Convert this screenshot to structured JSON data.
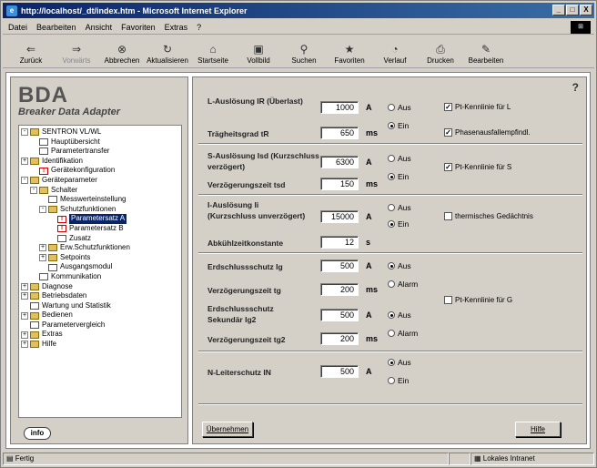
{
  "window": {
    "title": "http://localhost/_dt/index.htm - Microsoft Internet Explorer",
    "controls": [
      "_",
      "□",
      "X"
    ]
  },
  "menu": [
    "Datei",
    "Bearbeiten",
    "Ansicht",
    "Favoriten",
    "Extras",
    "?"
  ],
  "toolbar": [
    {
      "label": "Zurück",
      "icon": "back-arrow-icon",
      "glyph": "⇐",
      "disabled": false
    },
    {
      "label": "Vorwärts",
      "icon": "forward-arrow-icon",
      "glyph": "⇒",
      "disabled": true
    },
    {
      "label": "Abbrechen",
      "icon": "stop-icon",
      "glyph": "⊗",
      "disabled": false
    },
    {
      "label": "Aktualisieren",
      "icon": "refresh-icon",
      "glyph": "↻",
      "disabled": false
    },
    {
      "label": "Startseite",
      "icon": "home-icon",
      "glyph": "⌂",
      "disabled": false
    },
    {
      "label": "Vollbild",
      "icon": "fullscreen-icon",
      "glyph": "▣",
      "disabled": false
    },
    {
      "label": "Suchen",
      "icon": "search-icon",
      "glyph": "⚲",
      "disabled": false
    },
    {
      "label": "Favoriten",
      "icon": "favorites-icon",
      "glyph": "★",
      "disabled": false
    },
    {
      "label": "Verlauf",
      "icon": "history-icon",
      "glyph": "◔",
      "disabled": false
    },
    {
      "label": "Drucken",
      "icon": "print-icon",
      "glyph": "⎙",
      "disabled": false
    },
    {
      "label": "Bearbeiten",
      "icon": "edit-icon",
      "glyph": "✎",
      "disabled": false
    }
  ],
  "brand": {
    "title": "BDA",
    "subtitle": "Breaker Data Adapter"
  },
  "tree": [
    {
      "label": "SENTRON VL/WL",
      "level": 0,
      "icon": "folder",
      "exp": "-"
    },
    {
      "label": "Hauptübersicht",
      "level": 1,
      "icon": "page"
    },
    {
      "label": "Parametertransfer",
      "level": 1,
      "icon": "page"
    },
    {
      "label": "Identifikation",
      "level": 0,
      "icon": "folder",
      "exp": "+"
    },
    {
      "label": "Gerätekonfiguration",
      "level": 1,
      "icon": "red"
    },
    {
      "label": "Geräteparameter",
      "level": 0,
      "icon": "folder",
      "exp": "-"
    },
    {
      "label": "Schalter",
      "level": 1,
      "icon": "folder",
      "exp": "-"
    },
    {
      "label": "Messwerteinstellung",
      "level": 2,
      "icon": "page"
    },
    {
      "label": "Schutzfunktionen",
      "level": 2,
      "icon": "folder",
      "exp": "-"
    },
    {
      "label": "Parametersatz A",
      "level": 3,
      "icon": "red",
      "selected": true
    },
    {
      "label": "Parametersatz B",
      "level": 3,
      "icon": "red"
    },
    {
      "label": "Zusatz",
      "level": 3,
      "icon": "page"
    },
    {
      "label": "Erw.Schutzfunktionen",
      "level": 2,
      "icon": "folder",
      "exp": "+"
    },
    {
      "label": "Setpoints",
      "level": 2,
      "icon": "folder",
      "exp": "+"
    },
    {
      "label": "Ausgangsmodul",
      "level": 2,
      "icon": "page"
    },
    {
      "label": "Kommunikation",
      "level": 1,
      "icon": "page"
    },
    {
      "label": "Diagnose",
      "level": 0,
      "icon": "folder",
      "exp": "+"
    },
    {
      "label": "Betriebsdaten",
      "level": 0,
      "icon": "folder",
      "exp": "+"
    },
    {
      "label": "Wartung und Statistik",
      "level": 0,
      "icon": "page"
    },
    {
      "label": "Bedienen",
      "level": 0,
      "icon": "folder",
      "exp": "+"
    },
    {
      "label": "Parametervergleich",
      "level": 0,
      "icon": "page"
    },
    {
      "label": "Extras",
      "level": 0,
      "icon": "folder",
      "exp": "+"
    },
    {
      "label": "Hilfe",
      "level": 0,
      "icon": "folder",
      "exp": "+"
    }
  ],
  "info_button": "info",
  "help_mark": "?",
  "form": {
    "l_label": "L-Auslösung IR (Überlast)",
    "l_value": "1000",
    "l_unit": "A",
    "tr_label": "Trägheitsgrad tR",
    "tr_value": "650",
    "tr_unit": "ms",
    "l_radio_off": "Aus",
    "l_radio_on": "Ein",
    "chk_pt_l": "Pt-Kennlinie für L",
    "chk_phase": "Phasenausfallempfindl.",
    "s_label": "S-Auslösung Isd (Kurzschluss verzögert)",
    "s_value": "6300",
    "s_unit": "A",
    "tsd_label": "Verzögerungszeit tsd",
    "tsd_value": "150",
    "tsd_unit": "ms",
    "s_radio_off": "Aus",
    "s_radio_on": "Ein",
    "chk_pt_s": "Pt-Kennlinie für S",
    "i_label": "I-Auslösung Ii (Kurzschluss unverzögert)",
    "i_value": "15000",
    "i_unit": "A",
    "i_radio_off": "Aus",
    "i_radio_on": "Ein",
    "chk_therm": "thermisches Gedächtnis",
    "cool_label": "Abkühlzeitkonstante",
    "cool_value": "12",
    "cool_unit": "s",
    "g_label": "Erdschlussschutz Ig",
    "g_value": "500",
    "g_unit": "A",
    "tg_label": "Verzögerungszeit tg",
    "tg_value": "200",
    "tg_unit": "ms",
    "g_radio_off": "Aus",
    "g_radio_alarm": "Alarm",
    "chk_pt_g": "Pt-Kennlinie für G",
    "g2_label": "Erdschlussschutz Sekundär Ig2",
    "g2_value": "500",
    "g2_unit": "A",
    "tg2_label": "Verzögerungszeit tg2",
    "tg2_value": "200",
    "tg2_unit": "ms",
    "g2_radio_off": "Aus",
    "g2_radio_alarm": "Alarm",
    "n_label": "N-Leiterschutz IN",
    "n_value": "500",
    "n_unit": "A",
    "n_radio_off": "Aus",
    "n_radio_on": "Ein",
    "apply_button": "Übernehmen",
    "help_button": "Hilfe"
  },
  "status": {
    "left": "Fertig",
    "zone": "Lokales Intranet"
  }
}
